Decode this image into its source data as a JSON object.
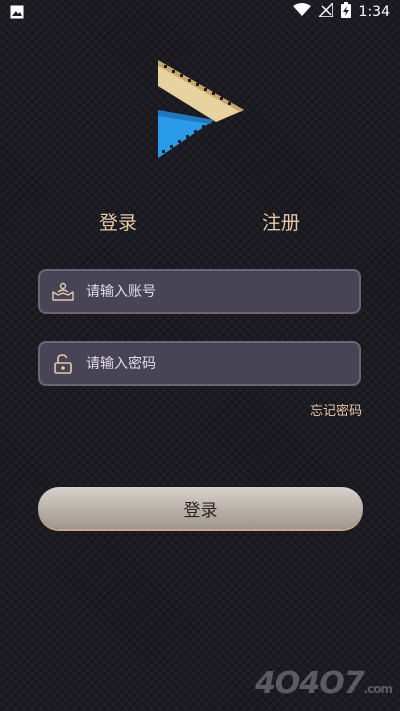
{
  "status_bar": {
    "time": "1:34",
    "icons": [
      "image-icon",
      "wifi-icon",
      "no-signal-icon",
      "battery-charging-icon"
    ]
  },
  "tabs": {
    "login": "登录",
    "register": "注册"
  },
  "form": {
    "account_placeholder": "请输入账号",
    "password_placeholder": "请输入密码",
    "account_icon": "user-account-icon",
    "password_icon": "unlock-icon"
  },
  "forgot_password": "忘记密码",
  "login_button": "登录",
  "colors": {
    "accent_gold": "#e6c9a8",
    "field_bg": "#474455",
    "logo_blue": "#2a9bea",
    "logo_gold": "#e8d2a0"
  }
}
